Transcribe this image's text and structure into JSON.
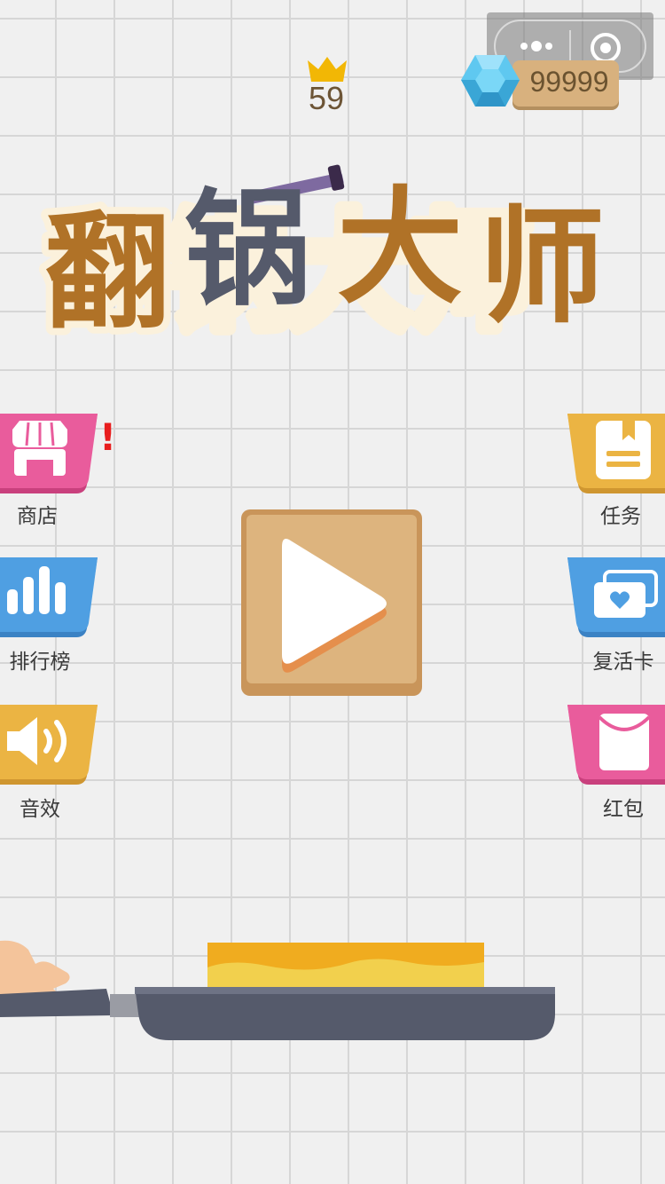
{
  "game": {
    "title": "翻锅大师",
    "best_score": "59",
    "diamonds": "99999"
  },
  "left_buttons": [
    {
      "label": "商店",
      "icon": "shop-icon",
      "color": "#e95c9c",
      "has_alert": true,
      "alert": "!"
    },
    {
      "label": "排行榜",
      "icon": "leaderboard-icon",
      "color": "#4f9fe2"
    },
    {
      "label": "音效",
      "icon": "speaker-icon",
      "color": "#ebb443"
    }
  ],
  "right_buttons": [
    {
      "label": "任务",
      "icon": "task-book-icon",
      "color": "#ebb443"
    },
    {
      "label": "复活卡",
      "icon": "revive-card-icon",
      "color": "#4f9fe2"
    },
    {
      "label": "红包",
      "icon": "red-envelope-icon",
      "color": "#e95c9c"
    }
  ],
  "play": {
    "icon": "play-icon"
  },
  "top_menu": {
    "icons": [
      "more-dots-icon",
      "close-target-icon"
    ]
  },
  "colors": {
    "title_brown": "#b07227",
    "title_slate": "#555a6b",
    "title_outline": "#fbf1dc",
    "pan": "#555a6b",
    "butter": "#f4d24a"
  }
}
